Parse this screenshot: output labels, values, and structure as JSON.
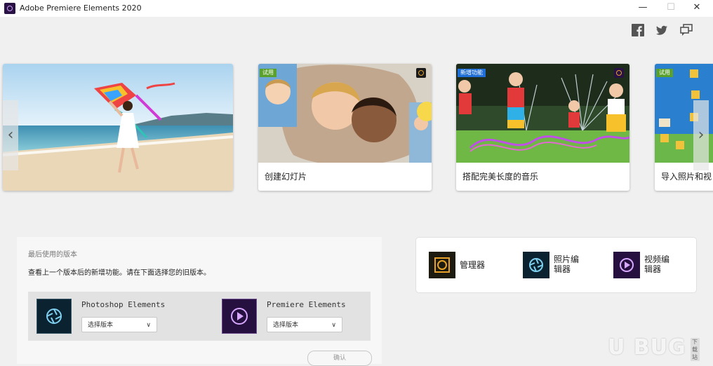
{
  "window": {
    "title": "Adobe Premiere Elements 2020",
    "minimize": "—",
    "maximize": "☐",
    "close": "✕"
  },
  "social": [
    "facebook-icon",
    "twitter-icon",
    "community-icon"
  ],
  "carousel": {
    "cards": [
      {
        "label": "",
        "badge": ""
      },
      {
        "label": "创建幻灯片",
        "badge": "试用"
      },
      {
        "label": "搭配完美长度的音乐",
        "badge": "新增功能"
      },
      {
        "label": "导入照片和视",
        "badge": "试用"
      }
    ],
    "prev": "‹",
    "next": "›"
  },
  "recent": {
    "title": "最后使用的版本",
    "description": "查看上一个版本后的新增功能。请在下面选择您的旧版本。",
    "products": [
      {
        "name": "Photoshop Elements",
        "select": "选择版本"
      },
      {
        "name": "Premiere Elements",
        "select": "选择版本"
      }
    ],
    "confirm": "确认"
  },
  "launcher": {
    "items": [
      {
        "line1": "管理器",
        "line2": ""
      },
      {
        "line1": "照片编",
        "line2": "辑器"
      },
      {
        "line1": "视频编",
        "line2": "辑器"
      }
    ]
  },
  "watermark": {
    "text": "U BUG",
    "tag": "下载站"
  },
  "colors": {
    "badge_green": "#5aa02c",
    "badge_blue": "#1f6fd6",
    "organizer_bg": "#1d1a10",
    "photo_bg": "#0b2230",
    "video_bg": "#26103f"
  }
}
